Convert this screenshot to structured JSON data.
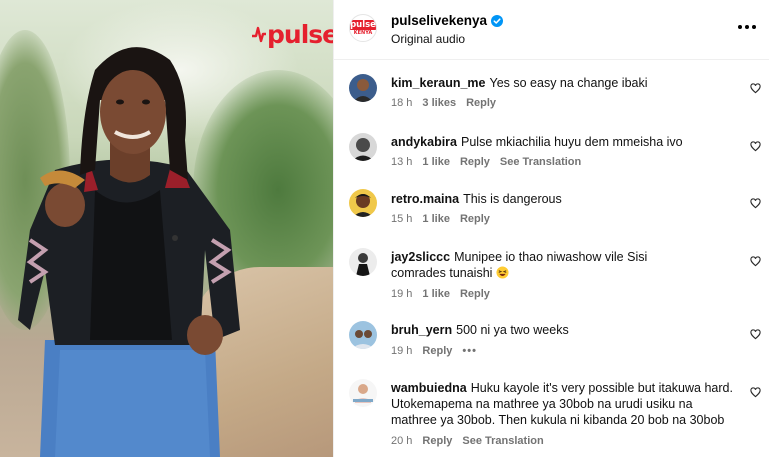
{
  "media": {
    "logo_text": "pulse"
  },
  "post": {
    "account": "pulselivekenya",
    "avatar_line1": "pulse",
    "avatar_line2": "KENYA",
    "subtitle": "Original audio"
  },
  "comments": [
    {
      "user": "kim_keraun_me",
      "text": "Yes so easy na change ibaki",
      "time": "18 h",
      "likes": "3 likes",
      "reply": "Reply",
      "extra": ""
    },
    {
      "user": "andykabira",
      "text": "Pulse mkiachilia huyu dem mmeisha ivo",
      "time": "13 h",
      "likes": "1 like",
      "reply": "Reply",
      "extra": "See Translation"
    },
    {
      "user": "retro.maina",
      "text": "This is dangerous",
      "time": "15 h",
      "likes": "1 like",
      "reply": "Reply",
      "extra": ""
    },
    {
      "user": "jay2sliccc",
      "text": "Munipee io thao niwashow vile Sisi comrades tunaishi",
      "time": "19 h",
      "likes": "1 like",
      "reply": "Reply",
      "extra": ""
    },
    {
      "user": "bruh_yern",
      "text": "500 ni ya two weeks",
      "time": "19 h",
      "likes": "",
      "reply": "Reply",
      "extra": "•••"
    },
    {
      "user": "wambuiedna",
      "text": "Huku kayole it's very possible but itakuwa hard. Utokemapema na mathree ya 30bob na urudi usiku na mathree ya 30bob. Then kukula ni kibanda 20 bob na 30bob",
      "time": "20 h",
      "likes": "",
      "reply": "Reply",
      "extra": "See Translation"
    }
  ],
  "icons": {
    "verified": "verified-badge-icon",
    "more": "more-options-icon",
    "like": "heart-icon"
  },
  "colors": {
    "brand_red": "#e5202e",
    "verified_blue": "#0095f6",
    "meta_gray": "#737373"
  }
}
